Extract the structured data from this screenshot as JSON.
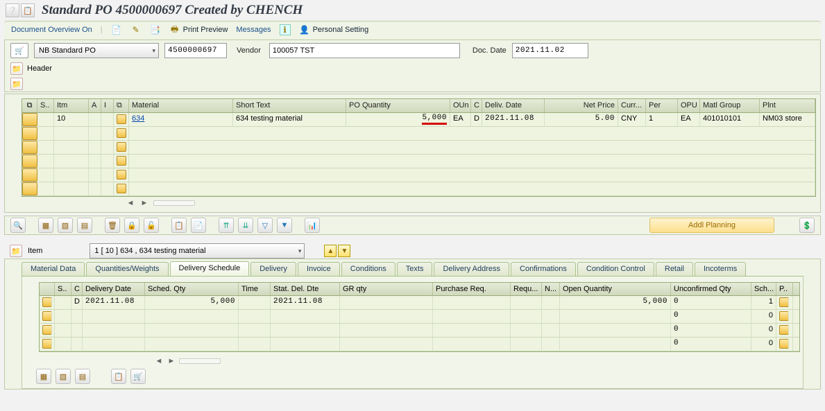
{
  "title": "Standard PO 4500000697 Created by CHENCH",
  "toolbar": {
    "doc_overview": "Document Overview On",
    "print_preview": "Print Preview",
    "messages": "Messages",
    "personal_setting": "Personal Setting"
  },
  "selection": {
    "po_type": "NB Standard PO",
    "po_number": "4500000697",
    "vendor_label": "Vendor",
    "vendor_value": "100057 TST",
    "doc_date_label": "Doc. Date",
    "doc_date_value": "2021.11.02"
  },
  "header_label": "Header",
  "item_grid": {
    "columns": {
      "s": "S..",
      "itm": "Itm",
      "a": "A",
      "i": "I",
      "material": "Material",
      "short_text": "Short Text",
      "po_qty": "PO Quantity",
      "oun": "OUn",
      "c": "C",
      "deliv_date": "Deliv. Date",
      "net_price": "Net Price",
      "curr": "Curr...",
      "per": "Per",
      "opu": "OPU",
      "matl_group": "Matl Group",
      "plnt": "Plnt"
    },
    "rows": [
      {
        "itm": "10",
        "material": "634",
        "short_text": "634 testing material",
        "po_qty": "5,000",
        "oun": "EA",
        "c": "D",
        "deliv_date": "2021.11.08",
        "net_price": "5.00",
        "curr": "CNY",
        "per": "1",
        "opu": "EA",
        "matl_group": "401010101",
        "plnt": "NM03 store"
      }
    ]
  },
  "item_toolbar": {
    "addl_planning": "Addl Planning"
  },
  "item_detail": {
    "label": "Item",
    "dropdown": "1 [ 10 ] 634 , 634 testing material"
  },
  "tabs": {
    "t1": "Material Data",
    "t2": "Quantities/Weights",
    "t3": "Delivery Schedule",
    "t4": "Delivery",
    "t5": "Invoice",
    "t6": "Conditions",
    "t7": "Texts",
    "t8": "Delivery Address",
    "t9": "Confirmations",
    "t10": "Condition Control",
    "t11": "Retail",
    "t12": "Incoterms"
  },
  "schedule": {
    "columns": {
      "s": "S..",
      "c": "C",
      "deliv_date": "Delivery Date",
      "sched_qty": "Sched. Qty",
      "time": "Time",
      "stat_del_dte": "Stat. Del. Dte",
      "gr_qty": "GR qty",
      "purchase_req": "Purchase Req.",
      "requ": "Requ...",
      "n": "N...",
      "open_qty": "Open Quantity",
      "unconfirmed_qty": "Unconfirmed Qty",
      "sch": "Sch...",
      "p": "P.."
    },
    "rows": [
      {
        "c": "D",
        "deliv_date": "2021.11.08",
        "sched_qty": "5,000",
        "stat_del_dte": "2021.11.08",
        "open_qty": "5,000",
        "unconfirmed": "0",
        "sch": "1"
      },
      {
        "unconfirmed": "0",
        "sch": "0"
      },
      {
        "unconfirmed": "0",
        "sch": "0"
      },
      {
        "unconfirmed": "0",
        "sch": "0"
      }
    ]
  }
}
